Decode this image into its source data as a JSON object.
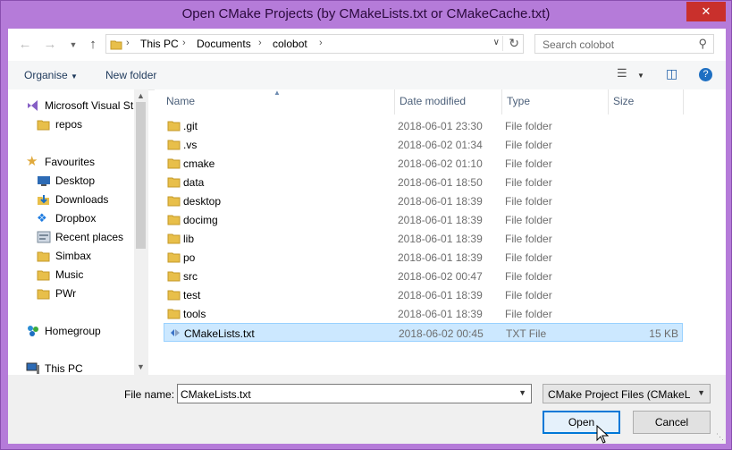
{
  "window": {
    "title": "Open CMake Projects (by CMakeLists.txt or CMakeCache.txt)",
    "close_glyph": "✕"
  },
  "address": {
    "crumbs": [
      "This PC",
      "Documents",
      "colobot"
    ]
  },
  "search": {
    "placeholder": "Search colobot"
  },
  "toolbar": {
    "organise_label": "Organise",
    "new_folder_label": "New folder"
  },
  "nav": {
    "items": [
      {
        "label": "Microsoft Visual St",
        "icon": "visual-studio-icon"
      },
      {
        "label": "repos",
        "icon": "folder-icon"
      },
      {
        "label": "Favourites",
        "icon": "star-icon"
      },
      {
        "label": "Desktop",
        "icon": "desktop-icon"
      },
      {
        "label": "Downloads",
        "icon": "downloads-icon"
      },
      {
        "label": "Dropbox",
        "icon": "dropbox-icon"
      },
      {
        "label": "Recent places",
        "icon": "recent-places-icon"
      },
      {
        "label": "Simbax",
        "icon": "folder-icon"
      },
      {
        "label": "Music",
        "icon": "folder-icon"
      },
      {
        "label": "PWr",
        "icon": "folder-icon"
      },
      {
        "label": "Homegroup",
        "icon": "homegroup-icon"
      },
      {
        "label": "This PC",
        "icon": "computer-icon"
      }
    ]
  },
  "columns": {
    "name": "Name",
    "date": "Date modified",
    "type": "Type",
    "size": "Size"
  },
  "files": [
    {
      "name": ".git",
      "date": "2018-06-01 23:30",
      "type": "File folder",
      "size": ""
    },
    {
      "name": ".vs",
      "date": "2018-06-02 01:34",
      "type": "File folder",
      "size": ""
    },
    {
      "name": "cmake",
      "date": "2018-06-02 01:10",
      "type": "File folder",
      "size": ""
    },
    {
      "name": "data",
      "date": "2018-06-01 18:50",
      "type": "File folder",
      "size": ""
    },
    {
      "name": "desktop",
      "date": "2018-06-01 18:39",
      "type": "File folder",
      "size": ""
    },
    {
      "name": "docimg",
      "date": "2018-06-01 18:39",
      "type": "File folder",
      "size": ""
    },
    {
      "name": "lib",
      "date": "2018-06-01 18:39",
      "type": "File folder",
      "size": ""
    },
    {
      "name": "po",
      "date": "2018-06-01 18:39",
      "type": "File folder",
      "size": ""
    },
    {
      "name": "src",
      "date": "2018-06-02 00:47",
      "type": "File folder",
      "size": ""
    },
    {
      "name": "test",
      "date": "2018-06-01 18:39",
      "type": "File folder",
      "size": ""
    },
    {
      "name": "tools",
      "date": "2018-06-01 18:39",
      "type": "File folder",
      "size": ""
    },
    {
      "name": "CMakeLists.txt",
      "date": "2018-06-02 00:45",
      "type": "TXT File",
      "size": "15 KB"
    }
  ],
  "footer": {
    "filename_label": "File name:",
    "filename_value": "CMakeLists.txt",
    "filetype_value": "CMake Project Files  (CMakeLis",
    "open_label": "Open",
    "cancel_label": "Cancel"
  },
  "colors": {
    "titlebar": "#b57bd9",
    "selection": "#cce8ff",
    "accent": "#0078d7"
  }
}
